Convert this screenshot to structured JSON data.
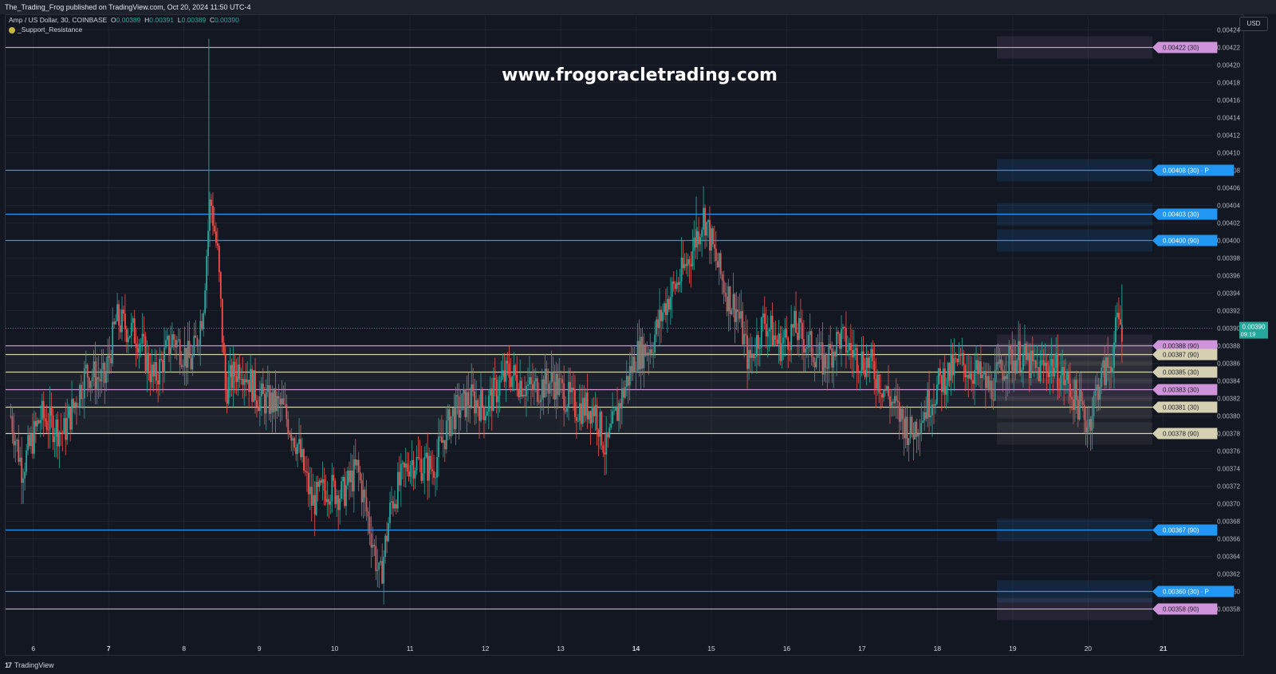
{
  "header": {
    "publisher": "The_Trading_Frog published on TradingView.com, Oct 20, 2024 11:50 UTC-4"
  },
  "legend": {
    "symbol": "Amp / US Dollar, 30, COINBASE",
    "open_label": "O",
    "open": "0.00389",
    "high_label": "H",
    "high": "0.00391",
    "low_label": "L",
    "low": "0.00389",
    "close_label": "C",
    "close": "0.00390",
    "indicator": "_Support_Resistance"
  },
  "watermark": "www.frogoracletrading.com",
  "currency_button": "USD",
  "footer": {
    "brand": "TradingView"
  },
  "colors": {
    "background": "#131722",
    "up": "#26a69a",
    "down": "#ef5350",
    "purple_level": "#ce93d8",
    "blue_level": "#2196f3",
    "beige_level": "#d6d0b3"
  },
  "chart_data": {
    "type": "candlestick",
    "title": "Amp / US Dollar, 30, COINBASE",
    "y_axis_ticks": [
      "0.00424",
      "0.00422",
      "0.00420",
      "0.00418",
      "0.00416",
      "0.00414",
      "0.00412",
      "0.00410",
      "0.00408",
      "0.00406",
      "0.00404",
      "0.00402",
      "0.00400",
      "0.00398",
      "0.00396",
      "0.00394",
      "0.00392",
      "0.00390",
      "0.00388",
      "0.00386",
      "0.00384",
      "0.00382",
      "0.00380",
      "0.00378",
      "0.00376",
      "0.00374",
      "0.00372",
      "0.00370",
      "0.00368",
      "0.00366",
      "0.00364",
      "0.00362",
      "0.00360",
      "0.00358"
    ],
    "ylim": [
      0.003565,
      0.004245
    ],
    "x_axis_ticks": [
      {
        "label": "6",
        "day": 6,
        "bold": false
      },
      {
        "label": "7",
        "day": 7,
        "bold": true
      },
      {
        "label": "8",
        "day": 8,
        "bold": false
      },
      {
        "label": "9",
        "day": 9,
        "bold": false
      },
      {
        "label": "10",
        "day": 10,
        "bold": false
      },
      {
        "label": "11",
        "day": 11,
        "bold": false
      },
      {
        "label": "12",
        "day": 12,
        "bold": false
      },
      {
        "label": "13",
        "day": 13,
        "bold": false
      },
      {
        "label": "14",
        "day": 14,
        "bold": true
      },
      {
        "label": "15",
        "day": 15,
        "bold": false
      },
      {
        "label": "16",
        "day": 16,
        "bold": false
      },
      {
        "label": "17",
        "day": 17,
        "bold": false
      },
      {
        "label": "18",
        "day": 18,
        "bold": false
      },
      {
        "label": "19",
        "day": 19,
        "bold": false
      },
      {
        "label": "20",
        "day": 20,
        "bold": false
      },
      {
        "label": "21",
        "day": 21,
        "bold": true
      }
    ],
    "current_price": {
      "value": 0.0039,
      "label": "0.00390",
      "countdown": "09:19"
    },
    "levels": [
      {
        "price": 0.00422,
        "label": "0.00422 (30)",
        "color": "purple"
      },
      {
        "price": 0.00408,
        "label": "0.00408 (30) · P",
        "color": "blue"
      },
      {
        "price": 0.00403,
        "label": "0.00403 (30)",
        "color": "blue"
      },
      {
        "price": 0.004,
        "label": "0.00400 (90)",
        "color": "blue"
      },
      {
        "price": 0.00388,
        "label": "0.00388 (90)",
        "color": "purple"
      },
      {
        "price": 0.00387,
        "label": "0.00387 (90)",
        "color": "beige"
      },
      {
        "price": 0.00385,
        "label": "0.00385 (30)",
        "color": "beige"
      },
      {
        "price": 0.00383,
        "label": "0.00383 (30)",
        "color": "purple"
      },
      {
        "price": 0.00381,
        "label": "0.00381 (30)",
        "color": "beige"
      },
      {
        "price": 0.00378,
        "label": "0.00378 (90)",
        "color": "beige"
      },
      {
        "price": 0.00367,
        "label": "0.00367 (90)",
        "color": "blue"
      },
      {
        "price": 0.0036,
        "label": "0.00360 (30) · P",
        "color": "blue"
      },
      {
        "price": 0.00358,
        "label": "0.00358 (90)",
        "color": "purple"
      }
    ],
    "price_path": [
      {
        "day": 5.7,
        "p": 0.0038
      },
      {
        "day": 5.85,
        "p": 0.00374
      },
      {
        "day": 6.1,
        "p": 0.0038
      },
      {
        "day": 6.4,
        "p": 0.00378
      },
      {
        "day": 6.7,
        "p": 0.00385
      },
      {
        "day": 6.95,
        "p": 0.00384
      },
      {
        "day": 7.1,
        "p": 0.00391
      },
      {
        "day": 7.4,
        "p": 0.00389
      },
      {
        "day": 7.6,
        "p": 0.00384
      },
      {
        "day": 7.85,
        "p": 0.00389
      },
      {
        "day": 8.1,
        "p": 0.00386
      },
      {
        "day": 8.25,
        "p": 0.00392
      },
      {
        "day": 8.35,
        "p": 0.00405
      },
      {
        "day": 8.45,
        "p": 0.00398
      },
      {
        "day": 8.55,
        "p": 0.00383
      },
      {
        "day": 8.75,
        "p": 0.00386
      },
      {
        "day": 9.0,
        "p": 0.00382
      },
      {
        "day": 9.3,
        "p": 0.00381
      },
      {
        "day": 9.5,
        "p": 0.00377
      },
      {
        "day": 9.7,
        "p": 0.0037
      },
      {
        "day": 9.9,
        "p": 0.00372
      },
      {
        "day": 10.1,
        "p": 0.00371
      },
      {
        "day": 10.3,
        "p": 0.00374
      },
      {
        "day": 10.5,
        "p": 0.00366
      },
      {
        "day": 10.6,
        "p": 0.00361
      },
      {
        "day": 10.75,
        "p": 0.0037
      },
      {
        "day": 11.0,
        "p": 0.00375
      },
      {
        "day": 11.3,
        "p": 0.00374
      },
      {
        "day": 11.55,
        "p": 0.0038
      },
      {
        "day": 11.8,
        "p": 0.00382
      },
      {
        "day": 12.0,
        "p": 0.00381
      },
      {
        "day": 12.3,
        "p": 0.00385
      },
      {
        "day": 12.6,
        "p": 0.00383
      },
      {
        "day": 12.9,
        "p": 0.00384
      },
      {
        "day": 13.2,
        "p": 0.00381
      },
      {
        "day": 13.45,
        "p": 0.00381
      },
      {
        "day": 13.6,
        "p": 0.00376
      },
      {
        "day": 13.8,
        "p": 0.00382
      },
      {
        "day": 14.0,
        "p": 0.00387
      },
      {
        "day": 14.2,
        "p": 0.00388
      },
      {
        "day": 14.4,
        "p": 0.00393
      },
      {
        "day": 14.6,
        "p": 0.00396
      },
      {
        "day": 14.75,
        "p": 0.00399
      },
      {
        "day": 14.9,
        "p": 0.00403
      },
      {
        "day": 15.05,
        "p": 0.00398
      },
      {
        "day": 15.2,
        "p": 0.00394
      },
      {
        "day": 15.35,
        "p": 0.00392
      },
      {
        "day": 15.5,
        "p": 0.00386
      },
      {
        "day": 15.7,
        "p": 0.00391
      },
      {
        "day": 15.9,
        "p": 0.00388
      },
      {
        "day": 16.1,
        "p": 0.0039
      },
      {
        "day": 16.3,
        "p": 0.00388
      },
      {
        "day": 16.5,
        "p": 0.00386
      },
      {
        "day": 16.7,
        "p": 0.00389
      },
      {
        "day": 16.9,
        "p": 0.00387
      },
      {
        "day": 17.1,
        "p": 0.00386
      },
      {
        "day": 17.3,
        "p": 0.00383
      },
      {
        "day": 17.5,
        "p": 0.0038
      },
      {
        "day": 17.65,
        "p": 0.00378
      },
      {
        "day": 17.85,
        "p": 0.00381
      },
      {
        "day": 18.05,
        "p": 0.00384
      },
      {
        "day": 18.3,
        "p": 0.00386
      },
      {
        "day": 18.5,
        "p": 0.00385
      },
      {
        "day": 18.7,
        "p": 0.00383
      },
      {
        "day": 18.9,
        "p": 0.00386
      },
      {
        "day": 19.1,
        "p": 0.00387
      },
      {
        "day": 19.3,
        "p": 0.00385
      },
      {
        "day": 19.5,
        "p": 0.00386
      },
      {
        "day": 19.7,
        "p": 0.00384
      },
      {
        "day": 19.9,
        "p": 0.00381
      },
      {
        "day": 20.0,
        "p": 0.00379
      },
      {
        "day": 20.15,
        "p": 0.00384
      },
      {
        "day": 20.3,
        "p": 0.00386
      },
      {
        "day": 20.4,
        "p": 0.00391
      },
      {
        "day": 20.45,
        "p": 0.0039
      }
    ]
  }
}
